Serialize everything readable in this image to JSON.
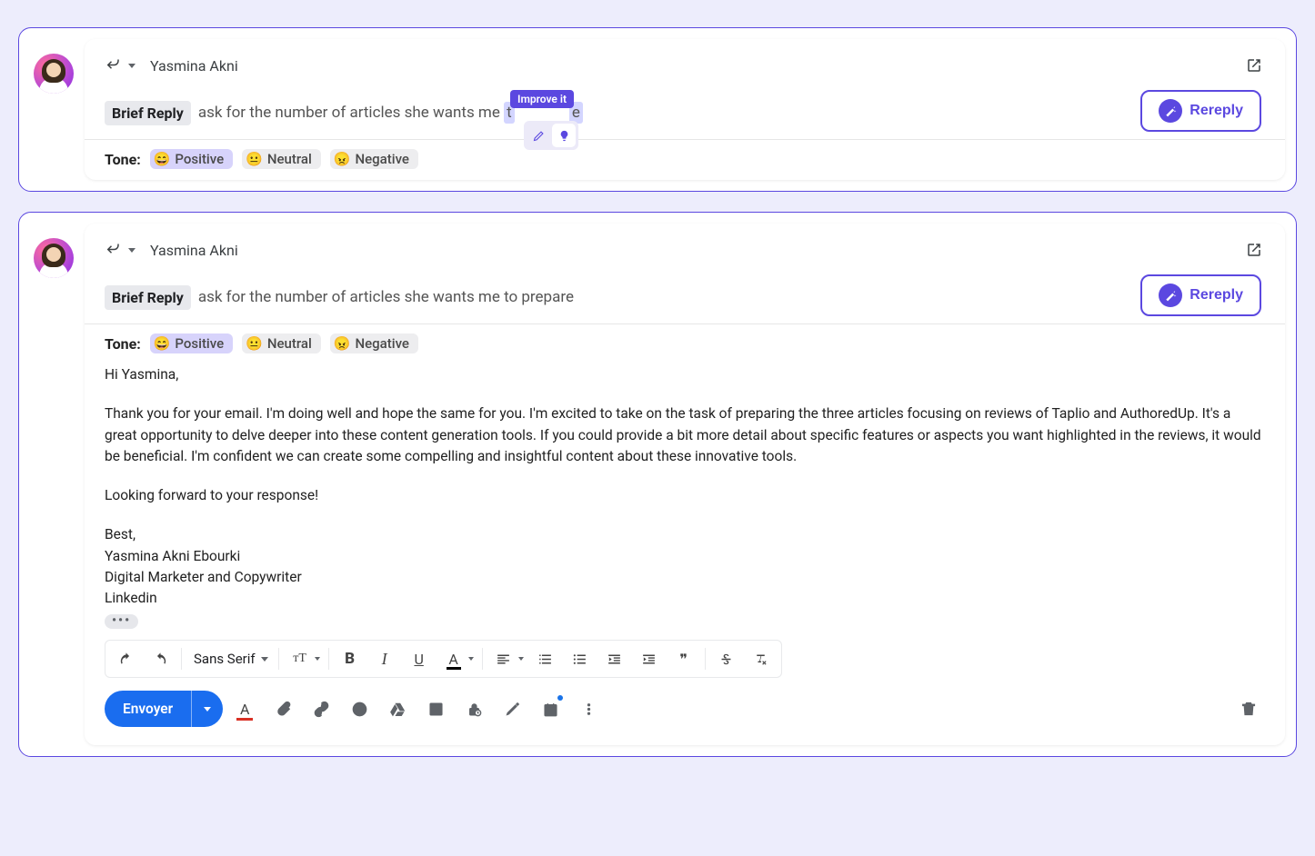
{
  "card1": {
    "sender": "Yasmina Akni",
    "brief_chip": "Brief Reply",
    "brief_prefix": "ask for the number of articles she wants me ",
    "brief_highlight_start": "t",
    "brief_highlight_end": "e",
    "improve_tooltip": "Improve it",
    "rereply_label": "Rereply",
    "tone_label": "Tone:",
    "tones": {
      "positive": "Positive",
      "neutral": "Neutral",
      "negative": "Negative"
    }
  },
  "card2": {
    "sender": "Yasmina Akni",
    "brief_chip": "Brief Reply",
    "brief_text": "ask for the number of articles she wants me to prepare",
    "rereply_label": "Rereply",
    "tone_label": "Tone:",
    "tones": {
      "positive": "Positive",
      "neutral": "Neutral",
      "negative": "Negative"
    },
    "body": {
      "greeting": "Hi Yasmina,",
      "p1": "Thank you for your email. I'm doing well and hope the same for you. I'm excited to take on the task of preparing the three articles focusing on reviews of Taplio and AuthoredUp. It's a great opportunity to delve deeper into these content generation tools. If you could provide a bit more detail about specific features or aspects you want highlighted in the reviews, it would be beneficial. I'm confident we can create some compelling and insightful content about these innovative tools.",
      "p2": "Looking forward to your response!",
      "sig1": "Best,",
      "sig2": "Yasmina Akni Ebourki",
      "sig3": "Digital Marketer and Copywriter",
      "sig4": "Linkedin"
    },
    "trimmed": "•••",
    "toolbar": {
      "font_name": "Sans Serif",
      "size_label": "тT",
      "bold": "B",
      "italic": "I",
      "underline": "U",
      "color_label": "A",
      "quote": "❞"
    },
    "send": {
      "label": "Envoyer"
    },
    "textaction_label": "A"
  },
  "colors": {
    "accent": "#5b48e0",
    "send": "#1a6def"
  }
}
